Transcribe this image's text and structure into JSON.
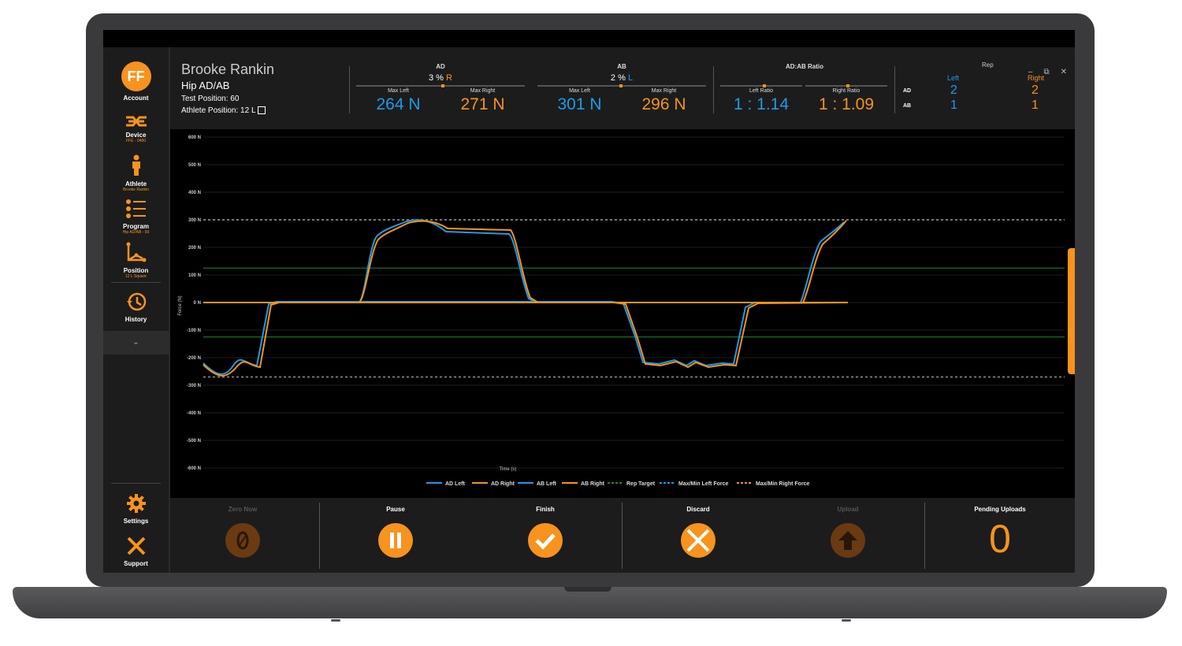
{
  "window": {
    "minimize": "–",
    "restore": "⧉",
    "close": "✕"
  },
  "sidebar": {
    "logo": "FF",
    "items": [
      {
        "label": "Account",
        "sub": ""
      },
      {
        "label": "Device",
        "sub": "FFE - 0480"
      },
      {
        "label": "Athlete",
        "sub": "Brooke Rankin"
      },
      {
        "label": "Program",
        "sub": "Hip AD/AB - 60"
      },
      {
        "label": "Position",
        "sub": "12 L Square"
      },
      {
        "label": "History",
        "sub": ""
      },
      {
        "label": "Settings",
        "sub": ""
      },
      {
        "label": "Support",
        "sub": ""
      }
    ],
    "expander": "⌄"
  },
  "header": {
    "athlete_name": "Brooke Rankin",
    "program": "Hip AD/AB",
    "test_position": "Test Position: 60",
    "athlete_position": "Athlete Position: 12 L",
    "ad": {
      "title": "AD",
      "pct": "3 %",
      "side": "R",
      "max_left_label": "Max Left",
      "max_left": "264 N",
      "max_right_label": "Max Right",
      "max_right": "271 N"
    },
    "ab": {
      "title": "AB",
      "pct": "2 %",
      "side": "L",
      "max_left_label": "Max Left",
      "max_left": "301 N",
      "max_right_label": "Max Right",
      "max_right": "296 N"
    },
    "ratio": {
      "title": "AD:AB Ratio",
      "left_label": "Left Ratio",
      "left": "1 : 1.14",
      "right_label": "Right Ratio",
      "right": "1 : 1.09"
    },
    "rep": {
      "title": "Rep",
      "left_head": "Left",
      "right_head": "Right",
      "ad_label": "AD",
      "ab_label": "AB",
      "ad_left": "2",
      "ad_right": "2",
      "ab_left": "1",
      "ab_right": "1"
    }
  },
  "chart_data": {
    "type": "line",
    "ylabel": "Force (N)",
    "xlabel": "Time (s)",
    "ylim": [
      -600,
      600
    ],
    "yticks": [
      "600 N",
      "500 N",
      "400 N",
      "300 N",
      "200 N",
      "100 N",
      "0 N",
      "-100 N",
      "-200 N",
      "-300 N",
      "-400 N",
      "-500 N",
      "-600 N"
    ],
    "legend": [
      "AD Left",
      "AD Right",
      "AB Left",
      "AB Right",
      "Rep Target",
      "Max/Min Left Force",
      "Max/Min Right Force"
    ],
    "rep_target": [
      125,
      -125
    ],
    "max_min_force": [
      300,
      -270
    ],
    "series": [
      {
        "name": "AD Left",
        "color": "#1f9be8",
        "x": [
          0,
          5,
          10,
          15,
          20,
          25,
          30,
          35,
          40,
          45,
          50,
          55,
          60,
          65,
          70,
          75,
          80,
          85,
          90,
          95,
          100
        ],
        "y": [
          -230,
          -270,
          -270,
          -210,
          -230,
          -10,
          0,
          0,
          0,
          0,
          0,
          0,
          0,
          0,
          0,
          0,
          0,
          0,
          0,
          0,
          0
        ]
      },
      {
        "name": "AD Right",
        "color": "#f7931e",
        "x": [
          0,
          5,
          10,
          15,
          20,
          25,
          30,
          35,
          40,
          45,
          50,
          55,
          60,
          65,
          70,
          75,
          80,
          85,
          90,
          95,
          100
        ],
        "y": [
          -240,
          -270,
          -275,
          -220,
          -240,
          -20,
          0,
          0,
          0,
          0,
          0,
          0,
          0,
          0,
          0,
          0,
          0,
          0,
          0,
          0,
          0
        ]
      },
      {
        "name": "AB Left",
        "color": "#1f9be8",
        "x": [
          0,
          5,
          10,
          15,
          20,
          25,
          30,
          35,
          40,
          45,
          50,
          55,
          60,
          65,
          70,
          75,
          80,
          85,
          90,
          95,
          100
        ],
        "y": [
          0,
          0,
          0,
          0,
          0,
          0,
          0,
          0,
          0,
          0,
          0,
          0,
          0,
          0,
          0,
          0,
          0,
          0,
          0,
          0,
          0
        ]
      },
      {
        "name": "AB Right",
        "color": "#f7931e",
        "x": [
          0,
          5,
          10,
          15,
          20,
          25,
          30,
          35,
          40,
          45,
          50,
          55,
          60,
          65,
          70,
          75,
          80,
          85,
          90,
          95,
          100
        ],
        "y": [
          0,
          0,
          0,
          0,
          0,
          0,
          0,
          0,
          0,
          0,
          0,
          0,
          0,
          0,
          0,
          0,
          0,
          0,
          0,
          0,
          0
        ]
      }
    ]
  },
  "actions": {
    "zero": "Zero Now",
    "pause": "Pause",
    "finish": "Finish",
    "discard": "Discard",
    "upload": "Upload",
    "pending_label": "Pending Uploads",
    "pending_value": "0"
  }
}
